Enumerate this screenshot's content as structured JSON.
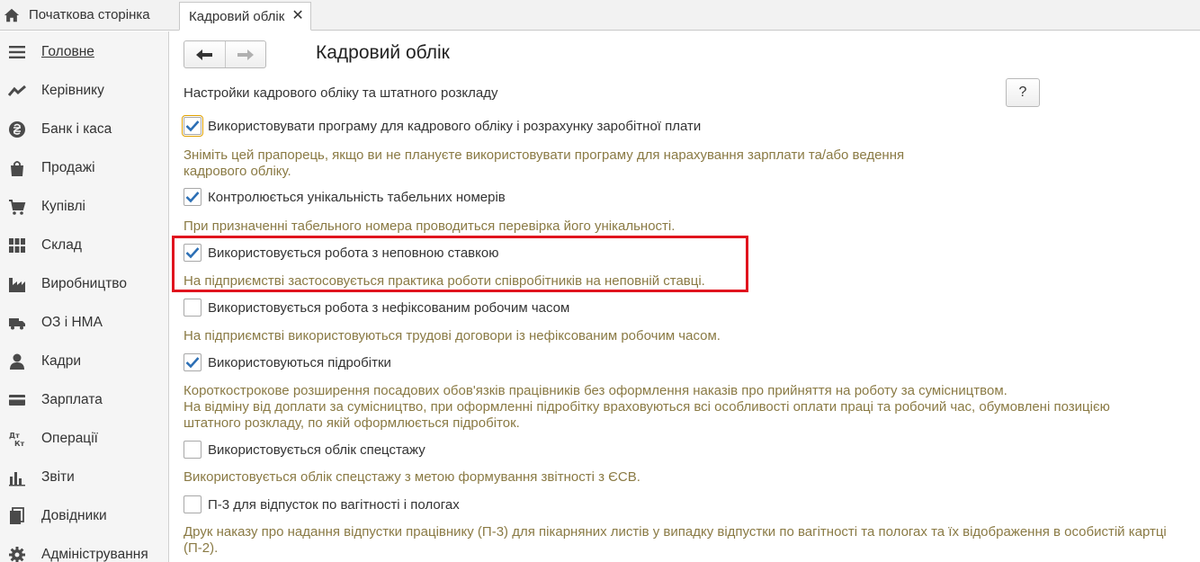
{
  "tabs": {
    "home_label": "Початкова сторінка",
    "active_label": "Кадровий облік",
    "close_glyph": "✕"
  },
  "sidebar": {
    "items": [
      {
        "label": "Головне",
        "icon": "menu-lines-icon"
      },
      {
        "label": "Керівнику",
        "icon": "trend-chart-icon"
      },
      {
        "label": "Банк і каса",
        "icon": "hryvnia-coin-icon"
      },
      {
        "label": "Продажі",
        "icon": "shopping-bag-icon"
      },
      {
        "label": "Купівлі",
        "icon": "shopping-cart-icon"
      },
      {
        "label": "Склад",
        "icon": "warehouse-grid-icon"
      },
      {
        "label": "Виробництво",
        "icon": "factory-icon"
      },
      {
        "label": "ОЗ і НМА",
        "icon": "truck-icon"
      },
      {
        "label": "Кадри",
        "icon": "person-icon"
      },
      {
        "label": "Зарплата",
        "icon": "card-icon"
      },
      {
        "label": "Операції",
        "icon": "dt-kt-icon"
      },
      {
        "label": "Звіти",
        "icon": "bar-chart-icon"
      },
      {
        "label": "Довідники",
        "icon": "books-icon"
      },
      {
        "label": "Адміністрування",
        "icon": "gear-icon"
      }
    ]
  },
  "main": {
    "title": "Кадровий облік",
    "section_title": "Настройки кадрового обліку та штатного розкладу",
    "help_label": "?",
    "options": [
      {
        "label": "Використовувати програму для кадрового обліку і розрахунку заробітної плати",
        "checked": true,
        "hint": "Зніміть цей прапорець, якщо ви не плануєте використовувати програму для нарахування зарплати та/або ведення\nкадрового обліку."
      },
      {
        "label": "Контролюється унікальність табельних номерів",
        "checked": true,
        "hint": "При призначенні табельного номера проводиться перевірка його унікальності."
      },
      {
        "label": "Використовується робота з неповною ставкою",
        "checked": true,
        "hint": "На підприємстві застосовується практика роботи співробітників на неповній ставці."
      },
      {
        "label": "Використовується робота з нефіксованим робочим часом",
        "checked": false,
        "hint": "На підприємстві використовуються трудові договори із нефіксованим робочим часом."
      },
      {
        "label": "Використовуються підробітки",
        "checked": true,
        "hint": "Короткострокове розширення посадових обов'язків працівників без оформлення наказів про прийняття на роботу за сумісництвом.\nНа відміну від доплати за сумісництво, при оформленні підробітку враховуються всі особливості оплати праці та робочий час, обумовлені позицією\nштатного розкладу, по якій оформлюється підробіток."
      },
      {
        "label": "Використовується облік спецстажу",
        "checked": false,
        "hint": "Використовується облік спецстажу з метою формування звітності з ЄСВ."
      },
      {
        "label": "П-3 для відпусток по вагітності і пологах",
        "checked": false,
        "hint": "Друк наказу про надання відпустки працівнику (П-3) для пікарняних листів у випадку відпустки по вагітності та пологах та їх відображення в особистій картці\n(П-2)."
      }
    ]
  },
  "colors": {
    "hint_text": "#8a7a44",
    "highlight_border": "#e0141e",
    "check_mark": "#2c6fb5"
  }
}
